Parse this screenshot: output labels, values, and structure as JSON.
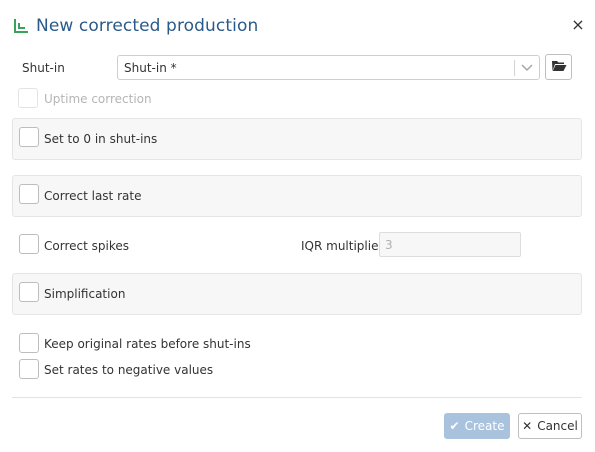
{
  "dialog": {
    "title": "New corrected production",
    "title_icon": "corrected-production-icon",
    "close_icon": "close-icon",
    "close_glyph": "×"
  },
  "shut_in": {
    "label": "Shut-in",
    "value": "Shut-in *",
    "dropdown_icon": "chevron-down-icon",
    "browse_icon": "folder-open-icon"
  },
  "options": {
    "uptime_correction": {
      "label": "Uptime correction",
      "checked": false,
      "disabled": true
    },
    "set_to_zero": {
      "label": "Set to 0 in shut-ins",
      "checked": false
    },
    "correct_last_rate": {
      "label": "Correct last rate",
      "checked": false
    },
    "correct_spikes": {
      "label": "Correct spikes",
      "checked": false
    },
    "simplification": {
      "label": "Simplification",
      "checked": false
    },
    "keep_original_rates": {
      "label": "Keep original rates before shut-ins",
      "checked": false
    },
    "negative_values": {
      "label": "Set rates to negative values",
      "checked": false
    }
  },
  "iqr": {
    "label": "IQR multiplier",
    "value": "3"
  },
  "footer": {
    "create_label": "Create",
    "create_icon": "check-icon",
    "create_glyph": "✔",
    "cancel_label": "Cancel",
    "cancel_icon": "close-icon",
    "cancel_glyph": "✕"
  },
  "colors": {
    "title": "#2a5a8a",
    "title_icon": "#3aa35a",
    "create_button": "#a9c3de",
    "panel_bg": "#f7f7f7"
  }
}
